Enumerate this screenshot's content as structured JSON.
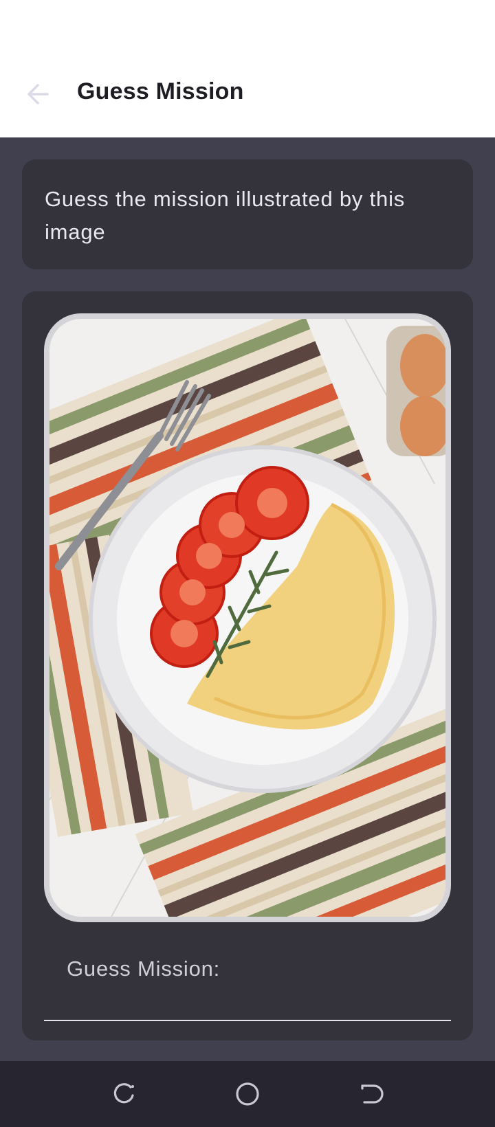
{
  "appbar": {
    "title": "Guess Mission",
    "back_icon": "arrow-left-icon"
  },
  "prompt": {
    "text": "Guess the mission illustrated by this image"
  },
  "image": {
    "description_icon": "omelette-plate-image"
  },
  "guess": {
    "label": "Guess Mission:",
    "value": ""
  },
  "navbar": {
    "recent_icon": "recent-apps-icon",
    "home_icon": "home-icon",
    "back_icon": "system-back-icon"
  },
  "colors": {
    "background": "#40404f",
    "card": "#34333c",
    "appbar": "#ffffff",
    "navbar": "#272630",
    "title": "#1e1d24"
  }
}
